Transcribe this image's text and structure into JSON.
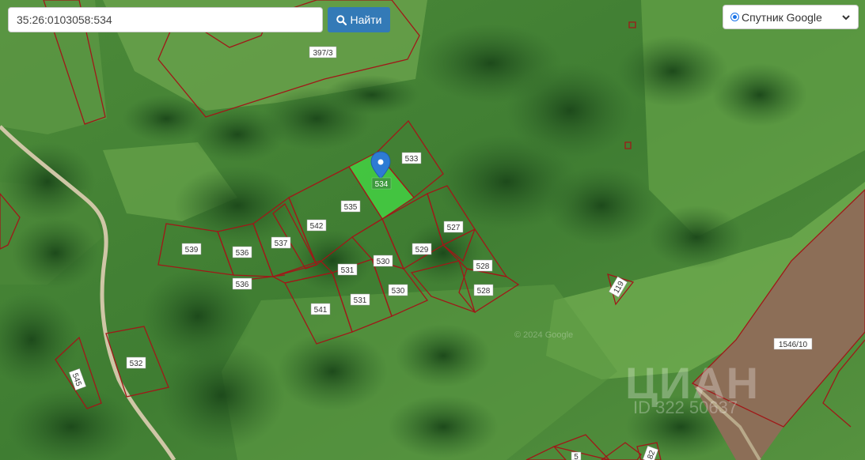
{
  "search": {
    "value": "35:26:0103058:534"
  },
  "find_button": {
    "label": "Найти",
    "icon": "search-icon"
  },
  "layer_select": {
    "selected": "Спутник Google",
    "icon": "chevron-down-icon"
  },
  "parcels": {
    "p397_3": "397/3",
    "p533": "533",
    "p534": "534",
    "p535": "535",
    "p542": "542",
    "p539": "539",
    "p536a": "536",
    "p536b": "536",
    "p537": "537",
    "p531a": "531",
    "p531b": "531",
    "p530a": "530",
    "p530b": "530",
    "p529": "529",
    "p527": "527",
    "p528a": "528",
    "p528b": "528",
    "p541": "541",
    "p532": "532",
    "p545": "545",
    "p119": "119",
    "p1546_10": "1546/10",
    "p82": "82",
    "p5x": "5"
  },
  "watermark": {
    "brand": "ЦИАН",
    "id_text": "ID 322 50637",
    "copyright": "© 2024 Google"
  },
  "colors": {
    "boundary": "#a01818",
    "selected_fill": "#3fd23f",
    "marker": "#2e7bd4",
    "button": "#337ab7"
  }
}
